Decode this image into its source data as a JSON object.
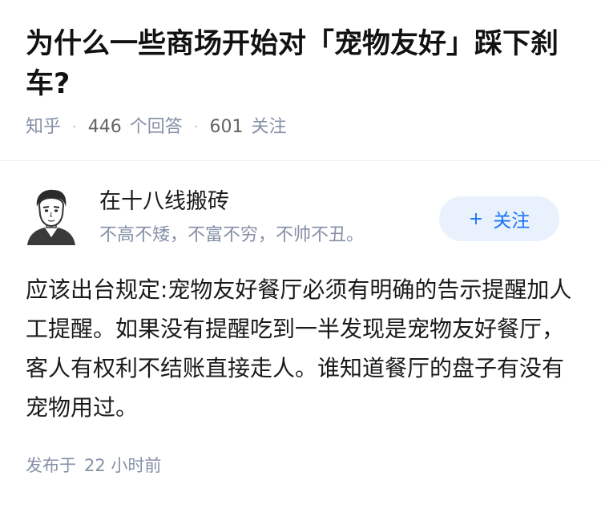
{
  "question": {
    "title": "为什么一些商场开始对「宠物友好」踩下刹车?",
    "source": "知乎",
    "answer_count": "446",
    "answer_label": "个回答",
    "follower_count": "601",
    "follower_label": "关注"
  },
  "author": {
    "name": "在十八线搬砖",
    "bio": "不高不矮，不富不穷，不帅不丑。",
    "avatar_icon": "avatar-icon",
    "follow_label": "关注",
    "follow_icon": "plus-icon",
    "follow_color": "#1772f6",
    "follow_bg": "#e9f2fc"
  },
  "answer": {
    "content": "应该出台规定:宠物友好餐厅必须有明确的告示提醒加人工提醒。如果没有提醒吃到一半发现是宠物友好餐厅，客人有权利不结账直接走人。谁知道餐厅的盘子有没有宠物用过。",
    "posted_label": "发布于",
    "posted_time": "22 小时前"
  }
}
